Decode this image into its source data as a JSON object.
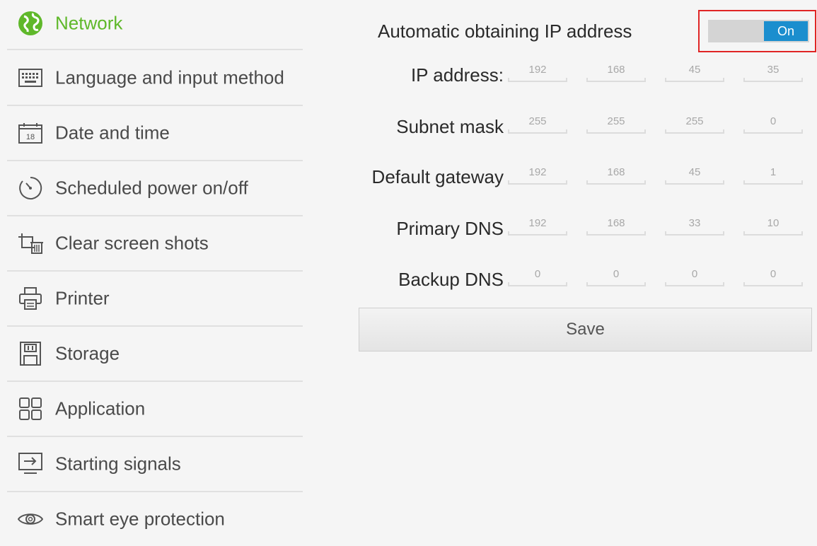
{
  "sidebar": {
    "items": [
      {
        "label": "Network",
        "icon": "globe-icon"
      },
      {
        "label": "Language and input method",
        "icon": "keyboard-icon"
      },
      {
        "label": "Date and time",
        "icon": "calendar-icon"
      },
      {
        "label": "Scheduled power on/off",
        "icon": "timer-icon"
      },
      {
        "label": "Clear screen shots",
        "icon": "crop-trash-icon"
      },
      {
        "label": "Printer",
        "icon": "printer-icon"
      },
      {
        "label": "Storage",
        "icon": "storage-icon"
      },
      {
        "label": "Application",
        "icon": "grid-icon"
      },
      {
        "label": "Starting signals",
        "icon": "input-signal-icon"
      },
      {
        "label": "Smart eye protection",
        "icon": "eye-icon"
      }
    ],
    "active_color": "#5fb82a"
  },
  "network": {
    "auto_ip_label": "Automatic obtaining IP address",
    "toggle_state": "On",
    "toggle_color": "#1b8ece",
    "highlight_color": "#e02525",
    "rows": [
      {
        "label": "IP address:",
        "values": [
          "192",
          "168",
          "45",
          "35"
        ]
      },
      {
        "label": "Subnet mask",
        "values": [
          "255",
          "255",
          "255",
          "0"
        ]
      },
      {
        "label": "Default gateway",
        "values": [
          "192",
          "168",
          "45",
          "1"
        ]
      },
      {
        "label": "Primary DNS",
        "values": [
          "192",
          "168",
          "33",
          "10"
        ]
      },
      {
        "label": "Backup DNS",
        "values": [
          "0",
          "0",
          "0",
          "0"
        ]
      }
    ],
    "save_label": "Save"
  }
}
